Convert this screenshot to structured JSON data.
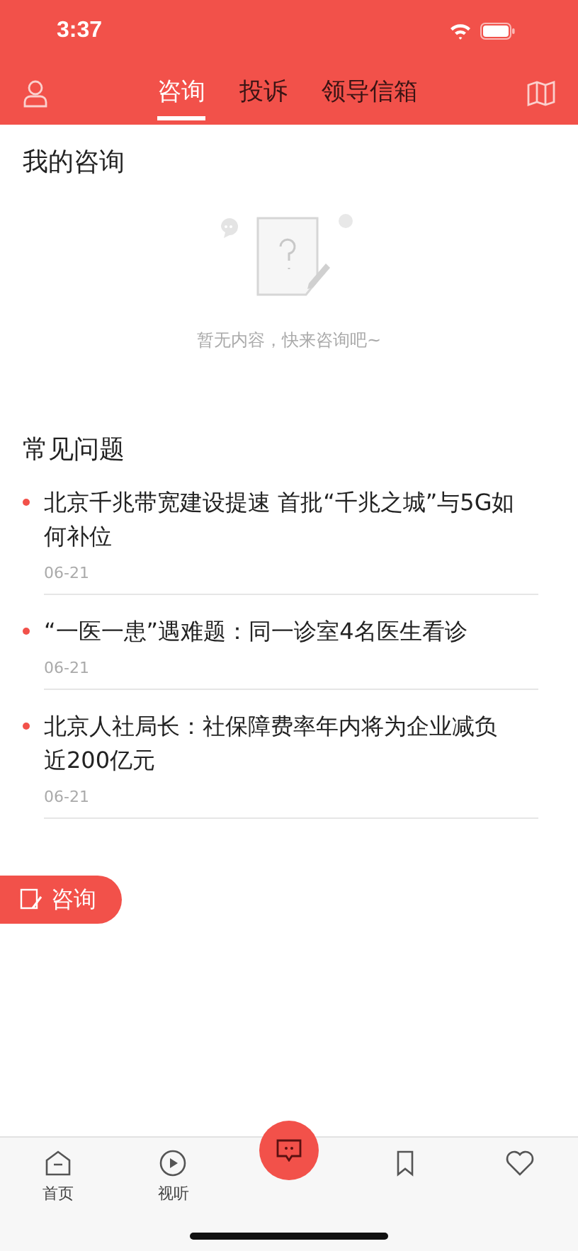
{
  "status_bar": {
    "time": "3:37"
  },
  "nav_tabs": [
    {
      "label": "咨询",
      "selected": true
    },
    {
      "label": "投诉",
      "selected": false
    },
    {
      "label": "领导信箱",
      "selected": false
    }
  ],
  "my_consultations": {
    "title": "我的咨询",
    "empty_message": "暂无内容，快来咨询吧~"
  },
  "faq": {
    "title": "常见问题",
    "items": [
      {
        "title": "北京千兆带宽建设提速 首批“千兆之城”与5G如何补位",
        "date": "06-21"
      },
      {
        "title": "“一医一患”遇难题：同一诊室4名医生看诊",
        "date": "06-21"
      },
      {
        "title": "北京人社局长：社保障费率年内将为企业减负近200亿元",
        "date": "06-21"
      }
    ]
  },
  "consult_button": {
    "label": "咨询"
  },
  "tab_bar": [
    {
      "kind": "home",
      "label": "首页"
    },
    {
      "kind": "play",
      "label": "视听"
    },
    {
      "kind": "center"
    },
    {
      "kind": "bookmark"
    },
    {
      "kind": "heart"
    }
  ]
}
